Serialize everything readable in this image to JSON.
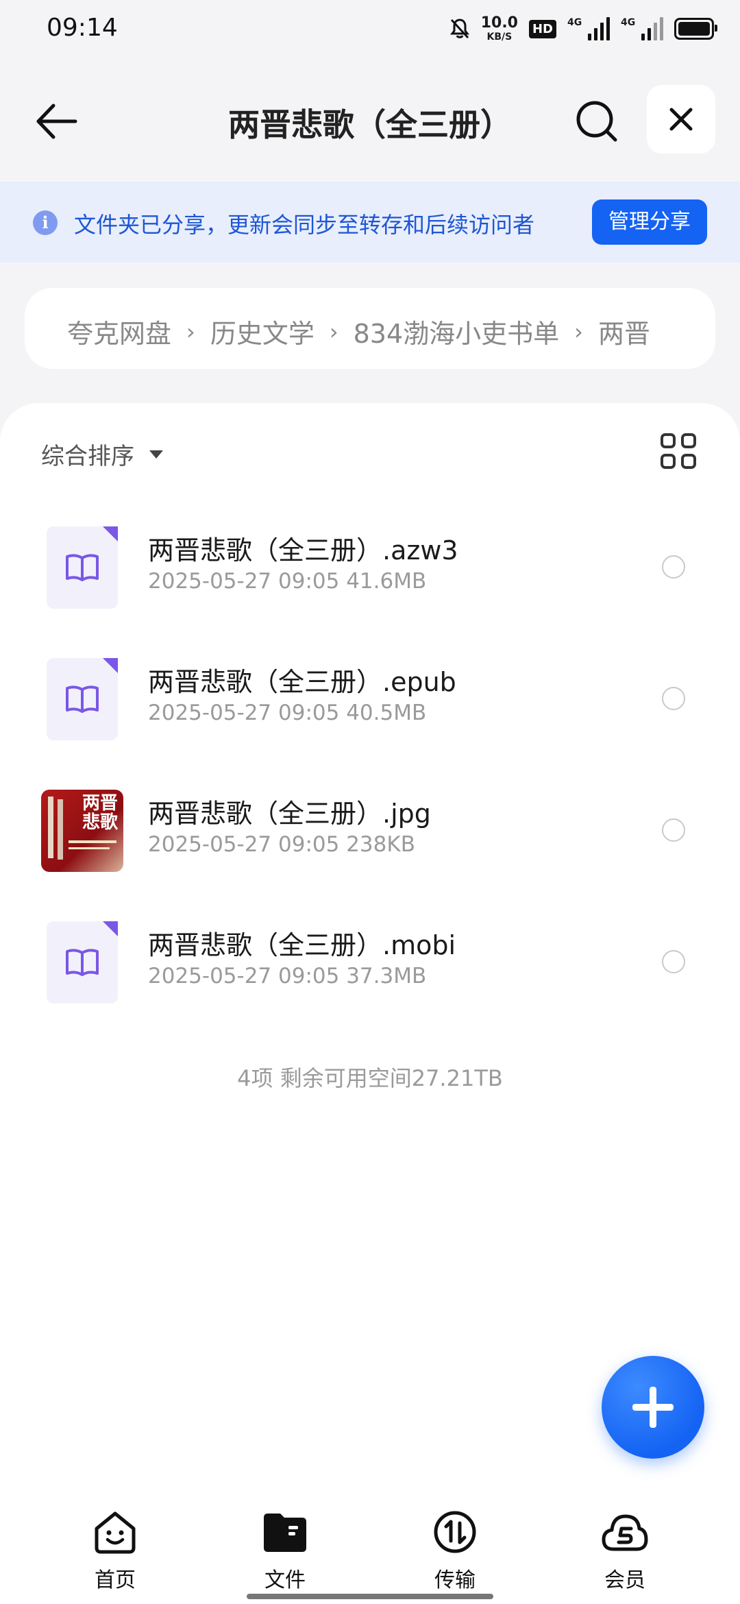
{
  "status": {
    "time": "09:14",
    "net_speed_value": "10.0",
    "net_speed_unit": "KB/S",
    "hd_label": "HD",
    "sim1": "4G",
    "sim2": "4G"
  },
  "header": {
    "title": "两晋悲歌（全三册）"
  },
  "banner": {
    "text": "文件夹已分享，更新会同步至转存和后续访问者",
    "button": "管理分享"
  },
  "breadcrumb": {
    "items": [
      "夸克网盘",
      "历史文学",
      "834渤海小吏书单",
      "两晋"
    ]
  },
  "toolbar": {
    "sort_label": "综合排序"
  },
  "files": [
    {
      "name": "两晋悲歌（全三册）.azw3",
      "meta": "2025-05-27 09:05  41.6MB",
      "type": "book"
    },
    {
      "name": "两晋悲歌（全三册）.epub",
      "meta": "2025-05-27 09:05  40.5MB",
      "type": "book"
    },
    {
      "name": "两晋悲歌（全三册）.jpg",
      "meta": "2025-05-27 09:05  238KB",
      "type": "image"
    },
    {
      "name": "两晋悲歌（全三册）.mobi",
      "meta": "2025-05-27 09:05  37.3MB",
      "type": "book"
    }
  ],
  "summary": "4项 剩余可用空间27.21TB",
  "thumb_text": "两晋悲歌",
  "tabs": [
    {
      "label": "首页",
      "icon": "home-smile-icon"
    },
    {
      "label": "文件",
      "icon": "folder-icon"
    },
    {
      "label": "传输",
      "icon": "transfer-icon"
    },
    {
      "label": "会员",
      "icon": "vip-cloud-icon"
    }
  ],
  "colors": {
    "accent": "#1463f3",
    "banner_bg": "#e8eefb",
    "book_corner": "#7a57e6"
  }
}
